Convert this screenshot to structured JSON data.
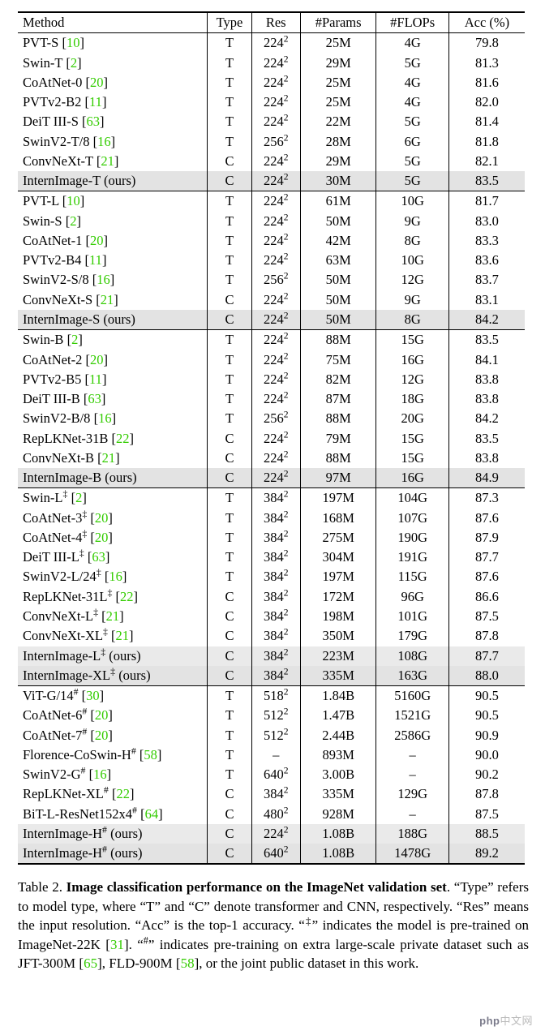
{
  "headers": {
    "method": "Method",
    "type": "Type",
    "res": "Res",
    "params": "#Params",
    "flops": "#FLOPs",
    "acc": "Acc (%)"
  },
  "chart_data": {
    "type": "table",
    "title": "Image classification performance on the ImageNet validation set",
    "columns": [
      "Method",
      "Type",
      "Res",
      "#Params",
      "#FLOPs",
      "Acc (%)"
    ],
    "groups": [
      {
        "rows": [
          {
            "method": "PVT-S",
            "ref": "10",
            "type": "T",
            "res_base": "224",
            "params": "25M",
            "flops": "4G",
            "acc": "79.8"
          },
          {
            "method": "Swin-T",
            "ref": "2",
            "type": "T",
            "res_base": "224",
            "params": "29M",
            "flops": "5G",
            "acc": "81.3"
          },
          {
            "method": "CoAtNet-0",
            "ref": "20",
            "type": "T",
            "res_base": "224",
            "params": "25M",
            "flops": "4G",
            "acc": "81.6"
          },
          {
            "method": "PVTv2-B2",
            "ref": "11",
            "type": "T",
            "res_base": "224",
            "params": "25M",
            "flops": "4G",
            "acc": "82.0"
          },
          {
            "method": "DeiT III-S",
            "ref": "63",
            "type": "T",
            "res_base": "224",
            "params": "22M",
            "flops": "5G",
            "acc": "81.4"
          },
          {
            "method": "SwinV2-T/8",
            "ref": "16",
            "type": "T",
            "res_base": "256",
            "params": "28M",
            "flops": "6G",
            "acc": "81.8"
          },
          {
            "method": "ConvNeXt-T",
            "ref": "21",
            "type": "C",
            "res_base": "224",
            "params": "29M",
            "flops": "5G",
            "acc": "82.1"
          },
          {
            "method": "InternImage-T (ours)",
            "type": "C",
            "res_base": "224",
            "params": "30M",
            "flops": "5G",
            "acc": "83.5",
            "hi": true
          }
        ]
      },
      {
        "rows": [
          {
            "method": "PVT-L",
            "ref": "10",
            "type": "T",
            "res_base": "224",
            "params": "61M",
            "flops": "10G",
            "acc": "81.7"
          },
          {
            "method": "Swin-S",
            "ref": "2",
            "type": "T",
            "res_base": "224",
            "params": "50M",
            "flops": "9G",
            "acc": "83.0"
          },
          {
            "method": "CoAtNet-1",
            "ref": "20",
            "type": "T",
            "res_base": "224",
            "params": "42M",
            "flops": "8G",
            "acc": "83.3"
          },
          {
            "method": "PVTv2-B4",
            "ref": "11",
            "type": "T",
            "res_base": "224",
            "params": "63M",
            "flops": "10G",
            "acc": "83.6"
          },
          {
            "method": "SwinV2-S/8",
            "ref": "16",
            "type": "T",
            "res_base": "256",
            "params": "50M",
            "flops": "12G",
            "acc": "83.7"
          },
          {
            "method": "ConvNeXt-S",
            "ref": "21",
            "type": "C",
            "res_base": "224",
            "params": "50M",
            "flops": "9G",
            "acc": "83.1"
          },
          {
            "method": "InternImage-S (ours)",
            "type": "C",
            "res_base": "224",
            "params": "50M",
            "flops": "8G",
            "acc": "84.2",
            "hi": true
          }
        ]
      },
      {
        "rows": [
          {
            "method": "Swin-B",
            "ref": "2",
            "type": "T",
            "res_base": "224",
            "params": "88M",
            "flops": "15G",
            "acc": "83.5"
          },
          {
            "method": "CoAtNet-2",
            "ref": "20",
            "type": "T",
            "res_base": "224",
            "params": "75M",
            "flops": "16G",
            "acc": "84.1"
          },
          {
            "method": "PVTv2-B5",
            "ref": "11",
            "type": "T",
            "res_base": "224",
            "params": "82M",
            "flops": "12G",
            "acc": "83.8"
          },
          {
            "method": "DeiT III-B",
            "ref": "63",
            "type": "T",
            "res_base": "224",
            "params": "87M",
            "flops": "18G",
            "acc": "83.8"
          },
          {
            "method": "SwinV2-B/8",
            "ref": "16",
            "type": "T",
            "res_base": "256",
            "params": "88M",
            "flops": "20G",
            "acc": "84.2"
          },
          {
            "method": "RepLKNet-31B",
            "ref": "22",
            "type": "C",
            "res_base": "224",
            "params": "79M",
            "flops": "15G",
            "acc": "83.5"
          },
          {
            "method": "ConvNeXt-B",
            "ref": "21",
            "type": "C",
            "res_base": "224",
            "params": "88M",
            "flops": "15G",
            "acc": "83.8"
          },
          {
            "method": "InternImage-B (ours)",
            "type": "C",
            "res_base": "224",
            "params": "97M",
            "flops": "16G",
            "acc": "84.9",
            "hi": true
          }
        ]
      },
      {
        "rows": [
          {
            "method": "Swin-L",
            "sup": "‡",
            "ref": "2",
            "type": "T",
            "res_base": "384",
            "params": "197M",
            "flops": "104G",
            "acc": "87.3"
          },
          {
            "method": "CoAtNet-3",
            "sup": "‡",
            "ref": "20",
            "type": "T",
            "res_base": "384",
            "params": "168M",
            "flops": "107G",
            "acc": "87.6"
          },
          {
            "method": "CoAtNet-4",
            "sup": "‡",
            "ref": "20",
            "type": "T",
            "res_base": "384",
            "params": "275M",
            "flops": "190G",
            "acc": "87.9"
          },
          {
            "method": "DeiT III-L",
            "sup": "‡",
            "ref": "63",
            "type": "T",
            "res_base": "384",
            "params": "304M",
            "flops": "191G",
            "acc": "87.7"
          },
          {
            "method": "SwinV2-L/24",
            "sup": "‡",
            "ref": "16",
            "type": "T",
            "res_base": "384",
            "params": "197M",
            "flops": "115G",
            "acc": "87.6"
          },
          {
            "method": "RepLKNet-31L",
            "sup": "‡",
            "ref": "22",
            "type": "C",
            "res_base": "384",
            "params": "172M",
            "flops": "96G",
            "acc": "86.6"
          },
          {
            "method": "ConvNeXt-L",
            "sup": "‡",
            "ref": "21",
            "type": "C",
            "res_base": "384",
            "params": "198M",
            "flops": "101G",
            "acc": "87.5"
          },
          {
            "method": "ConvNeXt-XL",
            "sup": "‡",
            "ref": "21",
            "type": "C",
            "res_base": "384",
            "params": "350M",
            "flops": "179G",
            "acc": "87.8"
          },
          {
            "method": "InternImage-L",
            "sup": "‡",
            "suffix": " (ours)",
            "type": "C",
            "res_base": "384",
            "params": "223M",
            "flops": "108G",
            "acc": "87.7",
            "hi2": true
          },
          {
            "method": "InternImage-XL",
            "sup": "‡",
            "suffix": " (ours)",
            "type": "C",
            "res_base": "384",
            "params": "335M",
            "flops": "163G",
            "acc": "88.0",
            "hi": true
          }
        ]
      },
      {
        "rows": [
          {
            "method": "ViT-G/14",
            "sup": "#",
            "ref": "30",
            "type": "T",
            "res_base": "518",
            "params": "1.84B",
            "flops": "5160G",
            "acc": "90.5"
          },
          {
            "method": "CoAtNet-6",
            "sup": "#",
            "ref": "20",
            "type": "T",
            "res_base": "512",
            "params": "1.47B",
            "flops": "1521G",
            "acc": "90.5"
          },
          {
            "method": "CoAtNet-7",
            "sup": "#",
            "ref": "20",
            "type": "T",
            "res_base": "512",
            "params": "2.44B",
            "flops": "2586G",
            "acc": "90.9"
          },
          {
            "method": "Florence-CoSwin-H",
            "sup": "#",
            "ref": "58",
            "type": "T",
            "res_base": "–",
            "params": "893M",
            "flops": "–",
            "acc": "90.0"
          },
          {
            "method": "SwinV2-G",
            "sup": "#",
            "ref": "16",
            "type": "T",
            "res_base": "640",
            "params": "3.00B",
            "flops": "–",
            "acc": "90.2"
          },
          {
            "method": "RepLKNet-XL",
            "sup": "#",
            "ref": "22",
            "type": "C",
            "res_base": "384",
            "params": "335M",
            "flops": "129G",
            "acc": "87.8"
          },
          {
            "method": "BiT-L-ResNet152x4",
            "sup": "#",
            "ref": "64",
            "type": "C",
            "res_base": "480",
            "params": "928M",
            "flops": "–",
            "acc": "87.5"
          },
          {
            "method": "InternImage-H",
            "sup": "#",
            "suffix": " (ours)",
            "type": "C",
            "res_base": "224",
            "params": "1.08B",
            "flops": "188G",
            "acc": "88.5",
            "hi2": true
          },
          {
            "method": "InternImage-H",
            "sup": "#",
            "suffix": " (ours)",
            "type": "C",
            "res_base": "640",
            "params": "1.08B",
            "flops": "1478G",
            "acc": "89.2",
            "hi": true
          }
        ]
      }
    ]
  },
  "caption": {
    "label": "Table 2.",
    "title": "Image classification performance on the ImageNet validation set",
    "body1": ". “Type” refers to model type, where “T” and “C” denote transformer and CNN, respectively. “Res” means the input resolution. “Acc” is the top-1 accuracy. “",
    "sup1": "‡",
    "body2": "” indicates the model is pre-trained on ImageNet-22K [",
    "ref1": "31",
    "body3": "]. “",
    "sup2": "#",
    "body4": "” indicates pre-training on extra large-scale private dataset such as JFT-300M [",
    "ref2": "65",
    "body5": "], FLD-900M [",
    "ref3": "58",
    "body6": "], or the joint public dataset in this work."
  },
  "watermark": {
    "php": "php",
    "cn": "中文网"
  }
}
